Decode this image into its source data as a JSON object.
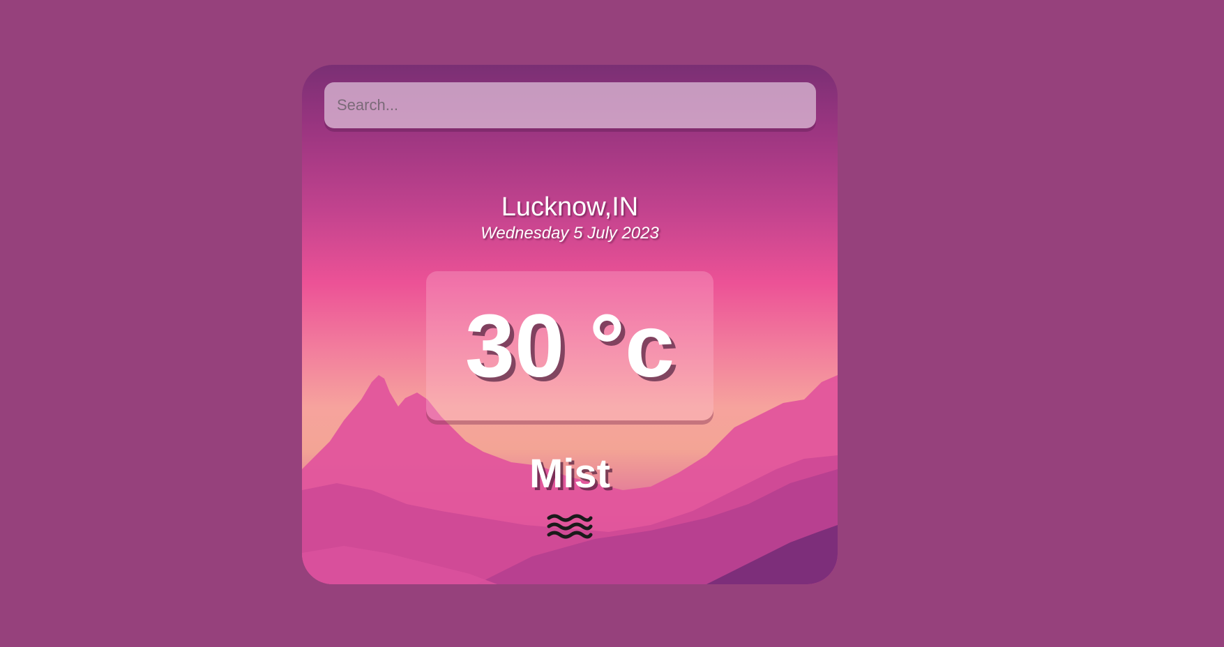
{
  "search": {
    "placeholder": "Search..."
  },
  "weather": {
    "location": "Lucknow,IN",
    "date": "Wednesday 5 July 2023",
    "temperature": "30 °c",
    "condition": "Mist",
    "condition_icon": "mist-icon"
  },
  "colors": {
    "page_background": "#96417c",
    "card_top": "#7a2f74",
    "card_mid": "#ec5296",
    "horizon": "#f6a39d",
    "text": "#ffffff"
  }
}
